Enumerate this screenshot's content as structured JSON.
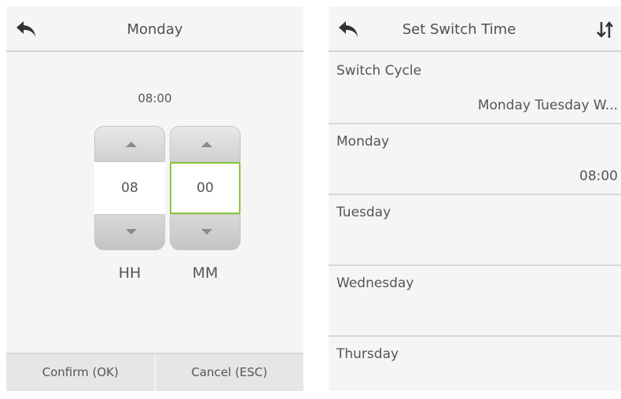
{
  "left": {
    "header": {
      "title": "Monday",
      "back_icon": "back-arrow-icon"
    },
    "time_display": "08:00",
    "hour": {
      "value": "08",
      "label": "HH"
    },
    "minute": {
      "value": "00",
      "label": "MM"
    },
    "buttons": {
      "confirm": "Confirm (OK)",
      "cancel": "Cancel (ESC)"
    },
    "colors": {
      "focus": "#8cc640"
    }
  },
  "right": {
    "header": {
      "title": "Set Switch Time",
      "back_icon": "back-arrow-icon",
      "sort_icon": "sort-arrows-icon"
    },
    "rows": [
      {
        "label": "Switch Cycle",
        "value": "Monday Tuesday W..."
      },
      {
        "label": "Monday",
        "value": "08:00"
      },
      {
        "label": "Tuesday",
        "value": ""
      },
      {
        "label": "Wednesday",
        "value": ""
      },
      {
        "label": "Thursday",
        "value": ""
      }
    ]
  }
}
